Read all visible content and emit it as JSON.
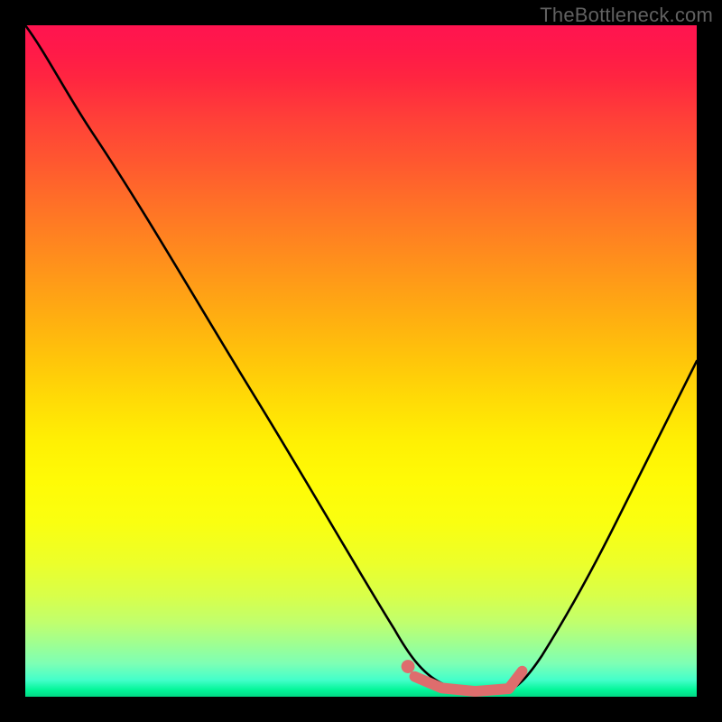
{
  "watermark": "TheBottleneck.com",
  "colors": {
    "frame": "#000000",
    "marker": "#de6d6d",
    "curve": "#000000",
    "gradient_top": "#ff1450",
    "gradient_mid": "#ffe205",
    "gradient_bottom": "#02d884"
  },
  "chart_data": {
    "type": "line",
    "title": "",
    "xlabel": "",
    "ylabel": "",
    "xlim": [
      0,
      100
    ],
    "ylim": [
      0,
      100
    ],
    "grid": false,
    "legend": false,
    "series": [
      {
        "name": "bottleneck-curve",
        "x": [
          0,
          5,
          10,
          15,
          20,
          25,
          30,
          35,
          40,
          45,
          50,
          55,
          57,
          62,
          67,
          72,
          74,
          78,
          82,
          86,
          90,
          94,
          98,
          100
        ],
        "values": [
          100,
          94,
          87,
          80,
          72,
          64,
          56,
          48,
          40,
          32,
          23,
          13,
          8,
          3,
          1,
          1,
          2,
          7,
          13,
          21,
          29,
          37,
          46,
          50
        ]
      }
    ],
    "marker": {
      "name": "highlight-segment",
      "x": [
        57,
        62,
        67,
        72,
        74
      ],
      "values": [
        4,
        2,
        1,
        1,
        5
      ],
      "dot": {
        "x": 57,
        "y": 4
      }
    },
    "background": "vertical-rainbow-gradient"
  }
}
